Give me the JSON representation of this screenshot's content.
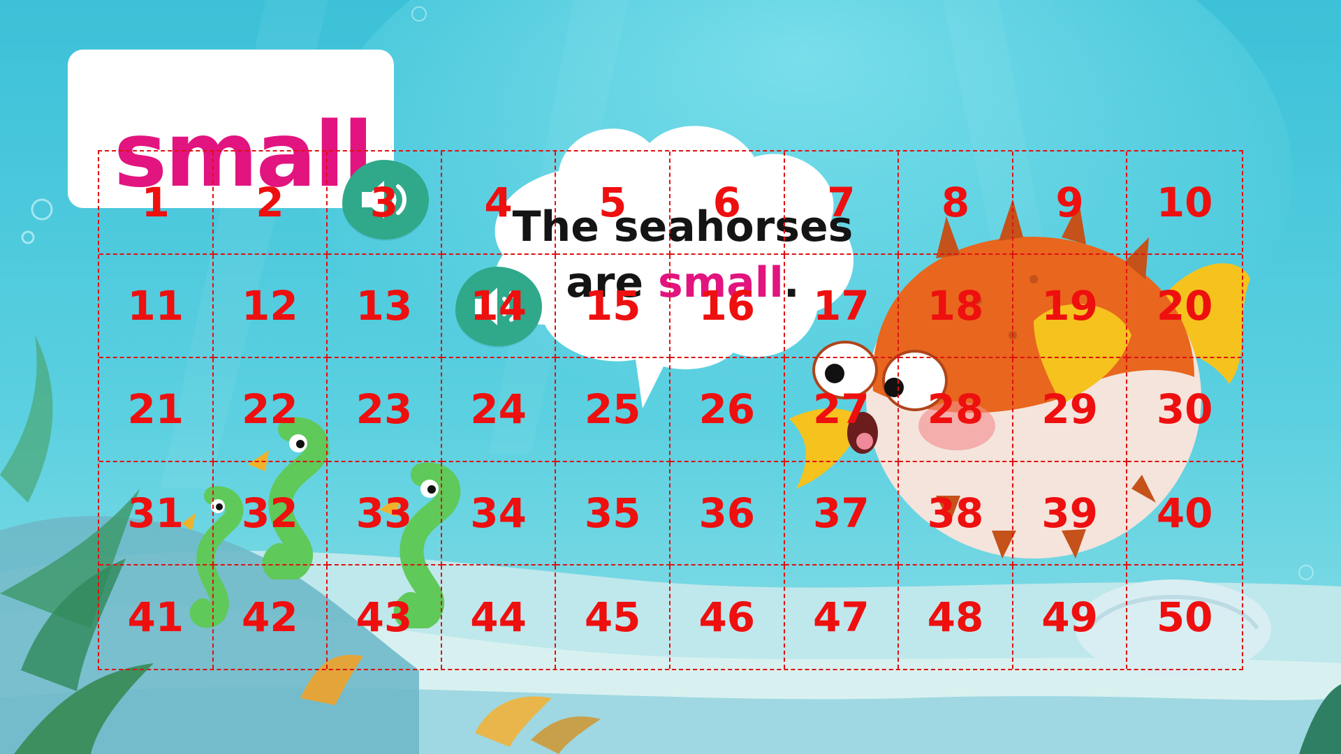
{
  "word_card": {
    "word": "small"
  },
  "speech_bubble": {
    "line1": "The seahorses",
    "line2_before": "are ",
    "line2_highlight": "small",
    "line2_after": "."
  },
  "audio_buttons": [
    {
      "icon": "speaker-icon"
    },
    {
      "icon": "speaker-icon"
    }
  ],
  "grid": {
    "rows": 5,
    "columns": 10,
    "cells": [
      "1",
      "2",
      "3",
      "4",
      "5",
      "6",
      "7",
      "8",
      "9",
      "10",
      "11",
      "12",
      "13",
      "14",
      "15",
      "16",
      "17",
      "18",
      "19",
      "20",
      "21",
      "22",
      "23",
      "24",
      "25",
      "26",
      "27",
      "28",
      "29",
      "30",
      "31",
      "32",
      "33",
      "34",
      "35",
      "36",
      "37",
      "38",
      "39",
      "40",
      "41",
      "42",
      "43",
      "44",
      "45",
      "46",
      "47",
      "48",
      "49",
      "50"
    ]
  },
  "colors": {
    "highlight": "#e2147f",
    "grid_lines": "#e01010",
    "grid_numbers": "#ee0f0f",
    "button": "#2fa98a",
    "water": "#4fc6dc"
  }
}
